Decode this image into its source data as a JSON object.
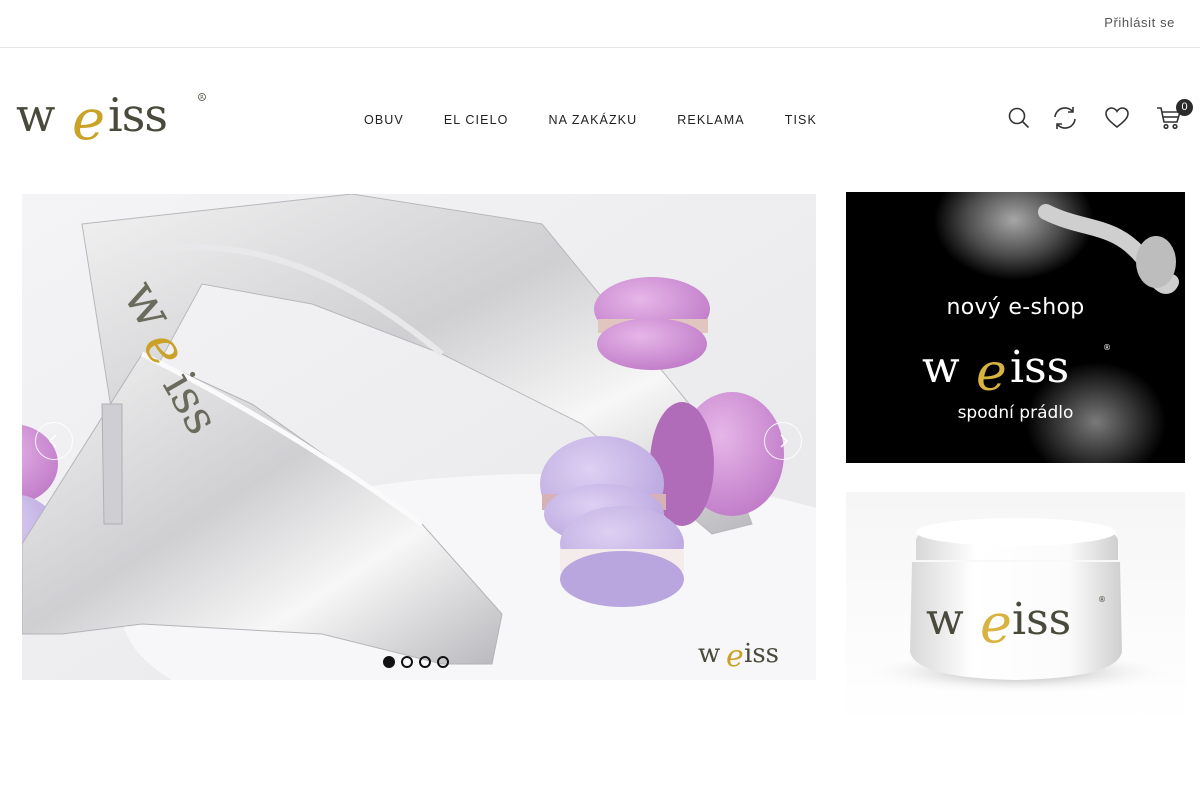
{
  "topbar": {
    "login_label": "Přihlásit se"
  },
  "header": {
    "logo_alt": "weiss",
    "nav": [
      {
        "label": "OBUV"
      },
      {
        "label": "EL CIELO"
      },
      {
        "label": "NA ZAKÁZKU"
      },
      {
        "label": "REKLAMA"
      },
      {
        "label": "TISK"
      }
    ],
    "icons": [
      "search-icon",
      "compare-icon",
      "heart-icon",
      "cart-icon"
    ],
    "cart_count": "0"
  },
  "slider": {
    "slide_count": 4,
    "active_index": 0,
    "prev_icon": "chevron-left-icon",
    "next_icon": "chevron-right-icon"
  },
  "banners": [
    {
      "line1": "nový  e-shop",
      "brand": "weiss",
      "line2": "spodní prádlo"
    },
    {
      "brand": "weiss"
    }
  ],
  "colors": {
    "brand_gold": "#c9a227",
    "brand_dark": "#4a4a3c",
    "nav_text": "#222222",
    "badge": "#2b2b2b"
  }
}
